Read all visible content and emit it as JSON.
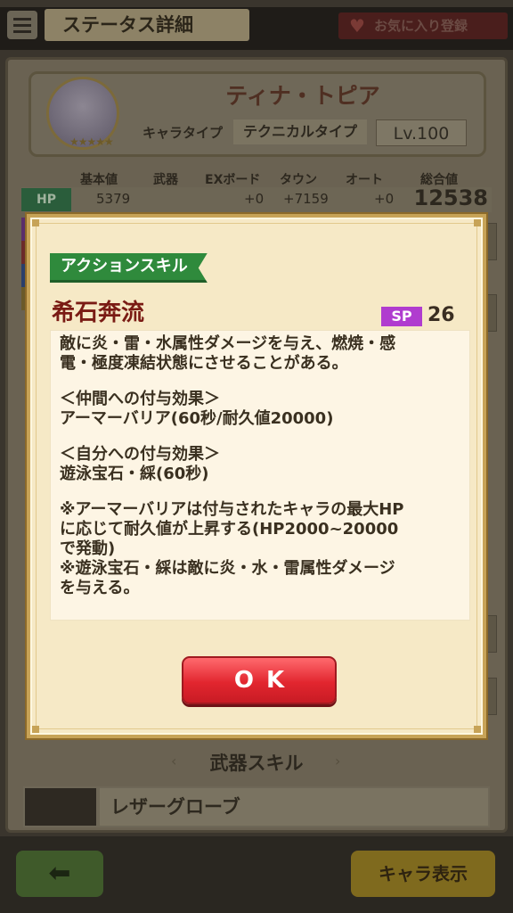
{
  "header": {
    "title": "ステータス詳細",
    "favorite_label": "お気に入り登録"
  },
  "character": {
    "name": "ティナ・トピア",
    "type_label": "キャラタイプ",
    "type_value": "テクニカルタイプ",
    "level": "Lv.100",
    "stars": "★★★★★"
  },
  "stats": {
    "columns": [
      "基本値",
      "武器",
      "EXボード",
      "タウン",
      "オート",
      "総合値"
    ],
    "hp": {
      "label": "HP",
      "base": "5379",
      "exboard": "+0",
      "town": "+7159",
      "auto": "+0",
      "total": "12538"
    }
  },
  "weapon_section": {
    "title": "武器スキル",
    "weapon_name": "レザーグローブ"
  },
  "footer": {
    "back_icon": "left-arrow-icon",
    "chara_button": "キャラ表示"
  },
  "modal": {
    "skill_type": "アクションスキル",
    "skill_name": "希石奔流",
    "sp_label": "SP",
    "sp_value": "26",
    "description_lines": [
      "敵に炎・雷・水属性ダメージを与え、燃焼・感",
      "電・極度凍結状態にさせることがある。",
      "",
      "＜仲間への付与効果＞",
      "アーマーバリア(60秒/耐久値20000)",
      "",
      "＜自分への付与効果＞",
      "遊泳宝石・綵(60秒)",
      "",
      "※アーマーバリアは付与されたキャラの最大HP",
      "に応じて耐久値が上昇する(HP2000~20000",
      "で発動)",
      "※遊泳宝石・綵は敵に炎・水・雷属性ダメージ",
      "を与える。"
    ],
    "ok_label": "OK"
  },
  "colors": {
    "modal_bg": "#f6e9c6",
    "skill_tag": "#2f8a3c",
    "skill_name": "#7a1b14",
    "sp_badge": "#b03ccf",
    "ok_button": "#e2262f"
  }
}
